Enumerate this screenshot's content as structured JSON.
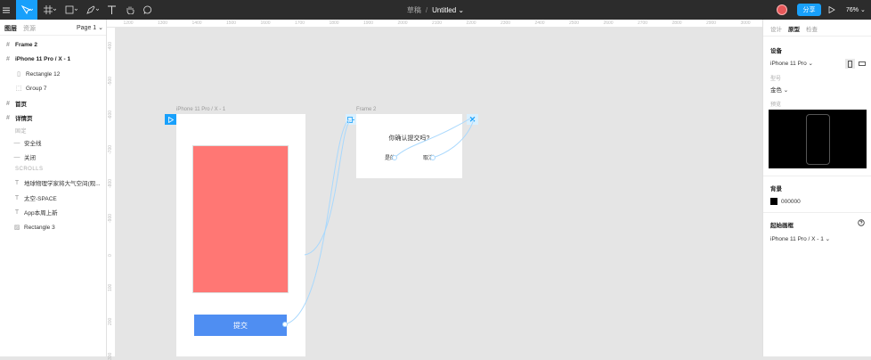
{
  "toolbar": {
    "breadcrumb": "草稿",
    "separator": "/",
    "file_name": "Untitled ⌄",
    "share_label": "分享",
    "zoom": "76% ⌄"
  },
  "left_panel": {
    "tabs": [
      "图层",
      "资源"
    ],
    "page": "Page 1 ⌄",
    "layers": [
      {
        "label": "Frame 2",
        "icon": "#"
      },
      {
        "label": "iPhone 11 Pro / X - 1",
        "icon": "#"
      },
      {
        "label": "Rectangle 12",
        "icon": "▯"
      },
      {
        "label": "Group 7",
        "icon": "⬚"
      },
      {
        "label": "首页",
        "icon": "#"
      },
      {
        "label": "详情页",
        "icon": "#"
      },
      {
        "label": "安全线",
        "icon": "—"
      },
      {
        "label": "关闭",
        "icon": "—"
      },
      {
        "label": "地球物理学家将大气空间(观...",
        "icon": "T"
      },
      {
        "label": "太空-SPACE",
        "icon": "T"
      },
      {
        "label": "App本周上新",
        "icon": "T"
      },
      {
        "label": "Rectangle 3",
        "icon": "▨"
      }
    ],
    "fixed_label": "固定",
    "scrolls_label": "SCROLLS"
  },
  "ruler": {
    "top_ticks": [
      "1200",
      "1300",
      "1400",
      "1500",
      "1600",
      "1700",
      "1800",
      "1900",
      "2000",
      "2100",
      "2200",
      "2300",
      "2400",
      "2500",
      "2600",
      "2700",
      "2800",
      "2900",
      "3000"
    ],
    "left_ticks": [
      "-400",
      "-500",
      "-600",
      "-700",
      "-800",
      "-900",
      "0",
      "100",
      "200",
      "300"
    ]
  },
  "canvas": {
    "iphone_label": "iPhone 11 Pro / X - 1",
    "frame2_label": "Frame 2",
    "submit_label": "提交",
    "dialog_question": "你确认提交吗?",
    "dialog_yes": "是的",
    "dialog_no": "取消",
    "red_color": "#ff7774",
    "button_color": "#4f8ef2"
  },
  "right_panel": {
    "tabs": [
      "设计",
      "原型",
      "检查"
    ],
    "device_title": "设备",
    "device_value": "iPhone 11 Pro ⌄",
    "model_label": "型号",
    "model_value": "金色 ⌄",
    "preview_label": "预览",
    "background_title": "背景",
    "background_value": "000000",
    "start_frame_title": "起始画框",
    "start_frame_value": "iPhone 11 Pro / X - 1 ⌄"
  }
}
